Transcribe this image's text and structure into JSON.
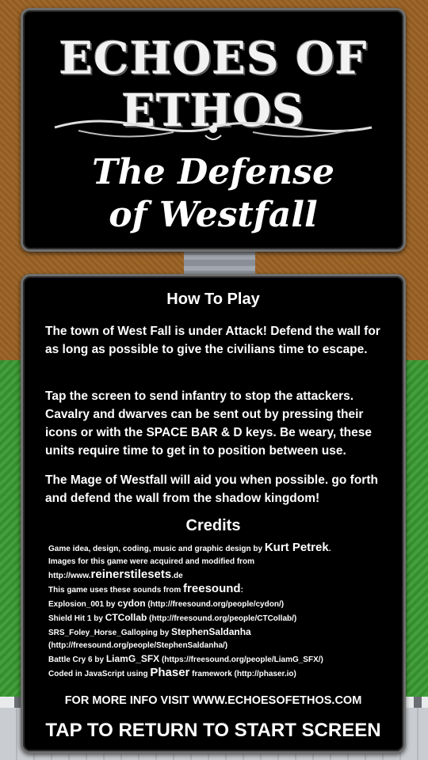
{
  "title_panel": {
    "game_title": "ECHOES OF ETHOS",
    "subtitle_line1": "The Defense",
    "subtitle_line2": "of Westfall"
  },
  "how_to_play": {
    "heading": "How To Play",
    "paragraphs": [
      "The town of West Fall is under Attack!  Defend the wall for as long as possible to give the civilians time to escape.",
      "Tap the screen to send infantry to stop the attackers. Cavalry and dwarves can be sent out by pressing their icons or with the SPACE BAR & D keys. Be weary, these units require time to get in to position between use.",
      "The Mage of Westfall will aid you when  possible.  go forth and defend the wall from the shadow kingdom!"
    ]
  },
  "credits": {
    "heading": "Credits",
    "line1_text": "Game idea, design, coding, music and graphic design by ",
    "line1_name": "Kurt Petrek",
    "line1_end": ".",
    "line2": "Images for this game were acquired and modified from",
    "line3_prefix": "http://www.",
    "line3_name": "reinerstilesets",
    "line3_suffix": ".de",
    "line4_text": "This game uses these sounds from ",
    "line4_name": "freesound",
    "line4_end": ":",
    "sounds": [
      {
        "title": "Explosion_001  by ",
        "author": "cydon",
        "url": " (http://freesound.org/people/cydon/)"
      },
      {
        "title": "Shield Hit 1  by ",
        "author": "CTCollab",
        "url": " (http://freesound.org/people/CTCollab/)"
      },
      {
        "title": "SRS_Foley_Horse_Galloping by ",
        "author": "StephenSaldanha",
        "url": ""
      },
      {
        "title": "",
        "author": "",
        "url": "(http://freesound.org/people/StephenSaldanha/)"
      },
      {
        "title": "Battle Cry 6 by ",
        "author": "LiamG_SFX",
        "url": "  (https://freesound.org/people/LiamG_SFX/)"
      }
    ],
    "line_last_text": "Coded in JavaScript using ",
    "line_last_name": "Phaser",
    "line_last_end": " framework (http://phaser.io)"
  },
  "more_info": "FOR MORE INFO VISIT WWW.ECHOESOFETHOS.COM",
  "tap_return": "TAP TO RETURN TO START SCREEN"
}
